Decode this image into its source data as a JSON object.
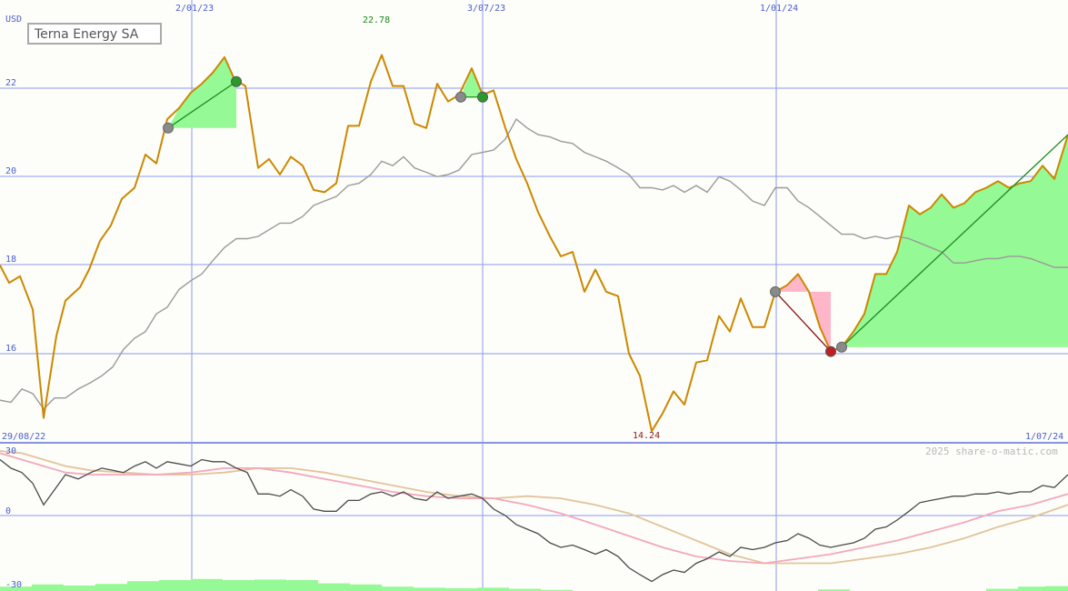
{
  "chart_data": {
    "type": "line",
    "title": "Terna Energy SA",
    "unit_label": "USD",
    "y_ticks": [
      "22",
      "20",
      "18",
      "16"
    ],
    "x_ticks": [
      "2/01/23",
      "3/07/23",
      "1/01/24"
    ],
    "start_date_label": "29/08/22",
    "end_date_label": "1/07/24",
    "high_label": "22.78",
    "low_label": "14.24",
    "credit": "2025 share-o-matic.com",
    "osc_ticks": [
      "30",
      "0",
      "-30"
    ],
    "colors": {
      "price": "#cc8800",
      "moving_average": "#9a9a9a",
      "gain_fill": "#95f995",
      "loss_fill": "#ffb6c8",
      "gain_line": "#1e8a1e",
      "loss_line": "#8a1010",
      "grid": "#8c9cf0",
      "osc_black": "#4a4a4a",
      "osc_pink": "#f4a8bc",
      "osc_tan": "#e2c49a"
    },
    "ylim": [
      14.2,
      22.8
    ],
    "price_series": [
      [
        0,
        18.0
      ],
      [
        10,
        17.6
      ],
      [
        22,
        17.75
      ],
      [
        36,
        17.0
      ],
      [
        48,
        14.55
      ],
      [
        62,
        16.4
      ],
      [
        72,
        17.2
      ],
      [
        88,
        17.5
      ],
      [
        98,
        17.9
      ],
      [
        110,
        18.55
      ],
      [
        122,
        18.9
      ],
      [
        134,
        19.5
      ],
      [
        148,
        19.75
      ],
      [
        160,
        20.5
      ],
      [
        172,
        20.3
      ],
      [
        184,
        21.3
      ],
      [
        197,
        21.55
      ],
      [
        210,
        21.9
      ],
      [
        222,
        22.1
      ],
      [
        234,
        22.35
      ],
      [
        247,
        22.7
      ],
      [
        258,
        22.2
      ],
      [
        270,
        22.05
      ],
      [
        284,
        20.2
      ],
      [
        296,
        20.4
      ],
      [
        308,
        20.05
      ],
      [
        320,
        20.45
      ],
      [
        333,
        20.25
      ],
      [
        345,
        19.7
      ],
      [
        357,
        19.65
      ],
      [
        370,
        19.85
      ],
      [
        383,
        21.15
      ],
      [
        395,
        21.15
      ],
      [
        408,
        22.15
      ],
      [
        420,
        22.75
      ],
      [
        432,
        22.05
      ],
      [
        444,
        22.05
      ],
      [
        456,
        21.2
      ],
      [
        469,
        21.1
      ],
      [
        481,
        22.1
      ],
      [
        493,
        21.7
      ],
      [
        505,
        21.85
      ],
      [
        519,
        22.45
      ],
      [
        531,
        21.85
      ],
      [
        543,
        21.95
      ],
      [
        556,
        21.1
      ],
      [
        568,
        20.4
      ],
      [
        580,
        19.85
      ],
      [
        592,
        19.2
      ],
      [
        605,
        18.65
      ],
      [
        617,
        18.2
      ],
      [
        630,
        18.3
      ],
      [
        643,
        17.4
      ],
      [
        655,
        17.9
      ],
      [
        667,
        17.4
      ],
      [
        680,
        17.3
      ],
      [
        692,
        16.0
      ],
      [
        704,
        15.5
      ],
      [
        717,
        14.25
      ],
      [
        729,
        14.65
      ],
      [
        741,
        15.15
      ],
      [
        753,
        14.85
      ],
      [
        766,
        15.8
      ],
      [
        778,
        15.85
      ],
      [
        791,
        16.85
      ],
      [
        803,
        16.5
      ],
      [
        815,
        17.25
      ],
      [
        828,
        16.6
      ],
      [
        841,
        16.6
      ],
      [
        853,
        17.4
      ],
      [
        866,
        17.55
      ],
      [
        878,
        17.8
      ],
      [
        890,
        17.4
      ],
      [
        902,
        16.6
      ],
      [
        914,
        16.05
      ],
      [
        926,
        16.15
      ],
      [
        939,
        16.5
      ],
      [
        951,
        16.9
      ],
      [
        963,
        17.8
      ],
      [
        975,
        17.8
      ],
      [
        987,
        18.3
      ],
      [
        1000,
        19.35
      ],
      [
        1012,
        19.15
      ],
      [
        1024,
        19.3
      ],
      [
        1036,
        19.6
      ],
      [
        1049,
        19.3
      ],
      [
        1061,
        19.4
      ],
      [
        1073,
        19.65
      ],
      [
        1085,
        19.75
      ],
      [
        1098,
        19.9
      ],
      [
        1110,
        19.75
      ],
      [
        1122,
        19.85
      ],
      [
        1134,
        19.9
      ],
      [
        1147,
        20.25
      ],
      [
        1160,
        19.95
      ],
      [
        1175,
        20.95
      ]
    ],
    "ma_series": [
      [
        0,
        14.95
      ],
      [
        12,
        14.9
      ],
      [
        24,
        15.2
      ],
      [
        36,
        15.1
      ],
      [
        48,
        14.75
      ],
      [
        60,
        15.0
      ],
      [
        72,
        15.0
      ],
      [
        86,
        15.2
      ],
      [
        100,
        15.35
      ],
      [
        112,
        15.5
      ],
      [
        124,
        15.7
      ],
      [
        136,
        16.1
      ],
      [
        148,
        16.35
      ],
      [
        160,
        16.5
      ],
      [
        172,
        16.9
      ],
      [
        184,
        17.05
      ],
      [
        197,
        17.45
      ],
      [
        210,
        17.65
      ],
      [
        222,
        17.8
      ],
      [
        234,
        18.1
      ],
      [
        247,
        18.4
      ],
      [
        260,
        18.6
      ],
      [
        272,
        18.6
      ],
      [
        284,
        18.65
      ],
      [
        296,
        18.8
      ],
      [
        308,
        18.95
      ],
      [
        320,
        18.95
      ],
      [
        333,
        19.1
      ],
      [
        345,
        19.35
      ],
      [
        357,
        19.45
      ],
      [
        370,
        19.55
      ],
      [
        383,
        19.8
      ],
      [
        395,
        19.85
      ],
      [
        408,
        20.05
      ],
      [
        420,
        20.35
      ],
      [
        432,
        20.25
      ],
      [
        444,
        20.45
      ],
      [
        456,
        20.2
      ],
      [
        469,
        20.1
      ],
      [
        481,
        20.0
      ],
      [
        493,
        20.05
      ],
      [
        505,
        20.15
      ],
      [
        519,
        20.5
      ],
      [
        531,
        20.55
      ],
      [
        543,
        20.6
      ],
      [
        556,
        20.85
      ],
      [
        568,
        21.3
      ],
      [
        580,
        21.1
      ],
      [
        592,
        20.95
      ],
      [
        605,
        20.9
      ],
      [
        617,
        20.8
      ],
      [
        630,
        20.75
      ],
      [
        643,
        20.55
      ],
      [
        655,
        20.45
      ],
      [
        667,
        20.35
      ],
      [
        680,
        20.2
      ],
      [
        692,
        20.05
      ],
      [
        704,
        19.75
      ],
      [
        717,
        19.75
      ],
      [
        729,
        19.7
      ],
      [
        741,
        19.8
      ],
      [
        753,
        19.65
      ],
      [
        766,
        19.8
      ],
      [
        778,
        19.65
      ],
      [
        791,
        20.0
      ],
      [
        803,
        19.9
      ],
      [
        815,
        19.7
      ],
      [
        828,
        19.45
      ],
      [
        841,
        19.35
      ],
      [
        853,
        19.75
      ],
      [
        866,
        19.75
      ],
      [
        878,
        19.45
      ],
      [
        890,
        19.3
      ],
      [
        902,
        19.1
      ],
      [
        914,
        18.9
      ],
      [
        926,
        18.7
      ],
      [
        939,
        18.7
      ],
      [
        951,
        18.6
      ],
      [
        963,
        18.65
      ],
      [
        975,
        18.6
      ],
      [
        987,
        18.65
      ],
      [
        1000,
        18.6
      ],
      [
        1012,
        18.5
      ],
      [
        1024,
        18.4
      ],
      [
        1036,
        18.3
      ],
      [
        1049,
        18.05
      ],
      [
        1061,
        18.05
      ],
      [
        1073,
        18.1
      ],
      [
        1085,
        18.15
      ],
      [
        1098,
        18.15
      ],
      [
        1110,
        18.2
      ],
      [
        1122,
        18.2
      ],
      [
        1134,
        18.15
      ],
      [
        1147,
        18.05
      ],
      [
        1160,
        17.95
      ],
      [
        1175,
        17.95
      ]
    ],
    "trades": [
      {
        "from": [
          185,
          21.1
        ],
        "to": [
          260,
          22.15
        ],
        "result": "gain"
      },
      {
        "from": [
          507,
          21.8
        ],
        "to": [
          531,
          21.8
        ],
        "result": "gain"
      },
      {
        "from": [
          853,
          17.4
        ],
        "to": [
          914,
          16.05
        ],
        "result": "loss"
      },
      {
        "from": [
          926,
          16.15
        ],
        "to": [
          1175,
          20.95
        ],
        "result": "gain"
      }
    ],
    "oscillator": {
      "ylim": [
        -30,
        30
      ],
      "black": [
        [
          0,
          26
        ],
        [
          12,
          22
        ],
        [
          24,
          20
        ],
        [
          36,
          15
        ],
        [
          48,
          5
        ],
        [
          60,
          12
        ],
        [
          72,
          19
        ],
        [
          86,
          17
        ],
        [
          100,
          20
        ],
        [
          112,
          22
        ],
        [
          124,
          21
        ],
        [
          136,
          20
        ],
        [
          148,
          23
        ],
        [
          160,
          25
        ],
        [
          172,
          22
        ],
        [
          184,
          25
        ],
        [
          197,
          24
        ],
        [
          210,
          23
        ],
        [
          222,
          26
        ],
        [
          234,
          25
        ],
        [
          247,
          25
        ],
        [
          260,
          22
        ],
        [
          272,
          20
        ],
        [
          284,
          10
        ],
        [
          296,
          10
        ],
        [
          308,
          9
        ],
        [
          320,
          12
        ],
        [
          333,
          9
        ],
        [
          345,
          3
        ],
        [
          357,
          2
        ],
        [
          370,
          2
        ],
        [
          383,
          7
        ],
        [
          395,
          7
        ],
        [
          408,
          10
        ],
        [
          420,
          11
        ],
        [
          432,
          9
        ],
        [
          444,
          11
        ],
        [
          456,
          8
        ],
        [
          469,
          7
        ],
        [
          481,
          11
        ],
        [
          493,
          8
        ],
        [
          505,
          9
        ],
        [
          519,
          10
        ],
        [
          531,
          8
        ],
        [
          543,
          3
        ],
        [
          556,
          0
        ],
        [
          568,
          -4
        ],
        [
          580,
          -6
        ],
        [
          592,
          -8
        ],
        [
          605,
          -12
        ],
        [
          617,
          -14
        ],
        [
          630,
          -13
        ],
        [
          643,
          -15
        ],
        [
          655,
          -17
        ],
        [
          667,
          -15
        ],
        [
          680,
          -18
        ],
        [
          692,
          -23
        ],
        [
          704,
          -26
        ],
        [
          717,
          -29
        ],
        [
          729,
          -26
        ],
        [
          741,
          -24
        ],
        [
          753,
          -25
        ],
        [
          766,
          -21
        ],
        [
          778,
          -19
        ],
        [
          791,
          -16
        ],
        [
          803,
          -18
        ],
        [
          815,
          -14
        ],
        [
          828,
          -15
        ],
        [
          841,
          -14
        ],
        [
          853,
          -12
        ],
        [
          866,
          -11
        ],
        [
          878,
          -8
        ],
        [
          890,
          -10
        ],
        [
          902,
          -13
        ],
        [
          914,
          -14
        ],
        [
          926,
          -13
        ],
        [
          939,
          -12
        ],
        [
          951,
          -10
        ],
        [
          963,
          -6
        ],
        [
          975,
          -5
        ],
        [
          987,
          -2
        ],
        [
          1000,
          2
        ],
        [
          1012,
          6
        ],
        [
          1024,
          7
        ],
        [
          1036,
          8
        ],
        [
          1049,
          9
        ],
        [
          1061,
          9
        ],
        [
          1073,
          10
        ],
        [
          1085,
          10
        ],
        [
          1098,
          11
        ],
        [
          1110,
          10
        ],
        [
          1122,
          11
        ],
        [
          1134,
          11
        ],
        [
          1147,
          14
        ],
        [
          1160,
          13
        ],
        [
          1175,
          19
        ]
      ],
      "pink": [
        [
          0,
          29
        ],
        [
          24,
          26
        ],
        [
          48,
          23
        ],
        [
          72,
          20
        ],
        [
          100,
          19
        ],
        [
          136,
          19
        ],
        [
          172,
          19
        ],
        [
          210,
          20
        ],
        [
          247,
          22
        ],
        [
          284,
          22
        ],
        [
          320,
          20
        ],
        [
          357,
          17
        ],
        [
          395,
          14
        ],
        [
          432,
          11
        ],
        [
          469,
          9
        ],
        [
          505,
          8
        ],
        [
          543,
          8
        ],
        [
          580,
          5
        ],
        [
          617,
          1
        ],
        [
          655,
          -4
        ],
        [
          692,
          -9
        ],
        [
          729,
          -14
        ],
        [
          766,
          -18
        ],
        [
          803,
          -20
        ],
        [
          841,
          -21
        ],
        [
          878,
          -19
        ],
        [
          914,
          -17
        ],
        [
          951,
          -14
        ],
        [
          987,
          -11
        ],
        [
          1024,
          -7
        ],
        [
          1061,
          -3
        ],
        [
          1098,
          2
        ],
        [
          1134,
          5
        ],
        [
          1175,
          10
        ]
      ],
      "tan": [
        [
          0,
          30
        ],
        [
          24,
          29
        ],
        [
          48,
          26
        ],
        [
          72,
          23
        ],
        [
          100,
          21
        ],
        [
          136,
          20
        ],
        [
          172,
          19
        ],
        [
          210,
          19
        ],
        [
          247,
          20
        ],
        [
          284,
          22
        ],
        [
          320,
          22
        ],
        [
          357,
          20
        ],
        [
          395,
          17
        ],
        [
          432,
          14
        ],
        [
          469,
          11
        ],
        [
          505,
          9
        ],
        [
          543,
          8
        ],
        [
          580,
          9
        ],
        [
          617,
          8
        ],
        [
          655,
          5
        ],
        [
          692,
          1
        ],
        [
          729,
          -5
        ],
        [
          766,
          -11
        ],
        [
          803,
          -17
        ],
        [
          841,
          -21
        ],
        [
          878,
          -21
        ],
        [
          914,
          -21
        ],
        [
          951,
          -19
        ],
        [
          987,
          -17
        ],
        [
          1024,
          -14
        ],
        [
          1061,
          -10
        ],
        [
          1098,
          -5
        ],
        [
          1134,
          -1
        ],
        [
          1175,
          5
        ]
      ]
    },
    "volume_bars": [
      [
        0,
        0.8
      ],
      [
        35,
        1.2
      ],
      [
        70,
        1.0
      ],
      [
        105,
        1.3
      ],
      [
        140,
        1.8
      ],
      [
        175,
        2.0
      ],
      [
        210,
        2.2
      ],
      [
        245,
        2.0
      ],
      [
        280,
        2.1
      ],
      [
        315,
        2.0
      ],
      [
        350,
        1.4
      ],
      [
        385,
        1.2
      ],
      [
        420,
        0.8
      ],
      [
        455,
        0.6
      ],
      [
        490,
        0.5
      ],
      [
        525,
        0.6
      ],
      [
        560,
        0.4
      ],
      [
        595,
        0.2
      ],
      [
        900,
        0.3
      ],
      [
        1085,
        0.4
      ],
      [
        1120,
        0.8
      ],
      [
        1150,
        0.9
      ]
    ]
  }
}
